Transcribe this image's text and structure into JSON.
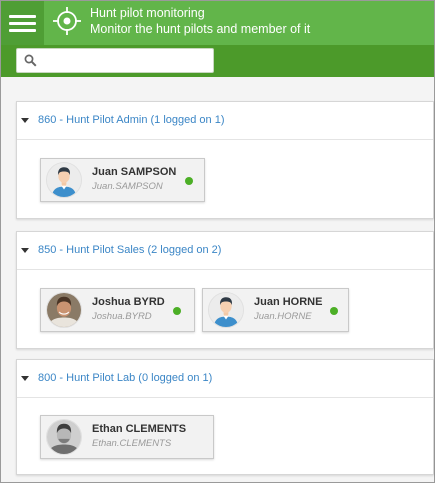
{
  "header": {
    "title": "Hunt pilot monitoring",
    "subtitle": "Monitor the hunt pilots and member of it"
  },
  "search": {
    "placeholder": "",
    "value": ""
  },
  "colors": {
    "header_bg": "#62b54a",
    "searchbar_bg": "#4c9a2a",
    "link": "#3b86c6",
    "status_online": "#4caf26"
  },
  "groups": [
    {
      "title": "860 - Hunt Pilot Admin (1 logged on 1)",
      "members": [
        {
          "name": "Juan SAMPSON",
          "login": "Juan.SAMPSON",
          "avatar": "male-default-avatar",
          "status": "online"
        }
      ]
    },
    {
      "title": "850 - Hunt Pilot Sales (2 logged on 2)",
      "members": [
        {
          "name": "Joshua BYRD",
          "login": "Joshua.BYRD",
          "avatar": "photo-avatar",
          "status": "online"
        },
        {
          "name": "Juan HORNE",
          "login": "Juan.HORNE",
          "avatar": "male-default-avatar",
          "status": "online"
        }
      ]
    },
    {
      "title": "800 - Hunt Pilot Lab (0 logged on 1)",
      "members": [
        {
          "name": "Ethan CLEMENTS",
          "login": "Ethan.CLEMENTS",
          "avatar": "grayscale-photo-avatar",
          "status": "offline"
        }
      ]
    }
  ]
}
